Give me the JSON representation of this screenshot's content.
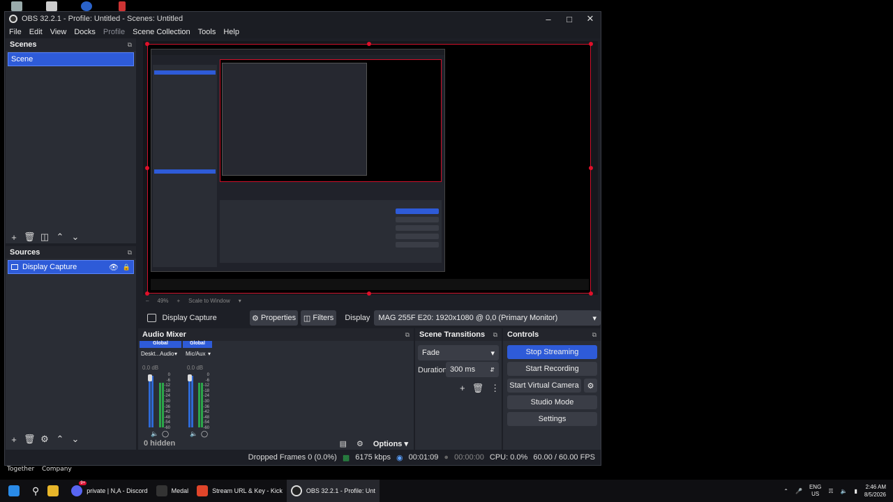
{
  "window": {
    "title": "OBS 32.2.1 - Profile: Untitled - Scenes: Untitled"
  },
  "menu": [
    "File",
    "Edit",
    "View",
    "Docks",
    "Profile",
    "Scene Collection",
    "Tools",
    "Help"
  ],
  "scenes": {
    "title": "Scenes",
    "items": [
      "Scene"
    ]
  },
  "sources": {
    "title": "Sources",
    "items": [
      "Display Capture"
    ]
  },
  "preview": {
    "zoom": "49%",
    "scale_mode": "Scale to Window"
  },
  "source_toolbar": {
    "source_name": "Display Capture",
    "properties_label": "Properties",
    "filters_label": "Filters",
    "display_label": "Display",
    "display_value": "MAG 255F E20: 1920x1080 @ 0,0 (Primary Monitor)"
  },
  "audio_mixer": {
    "title": "Audio Mixer",
    "channels": [
      {
        "badge": "Global",
        "name": "Deskt...Audio",
        "db": "0.0 dB"
      },
      {
        "badge": "Global",
        "name": "Mic/Aux",
        "db": "0.0 dB"
      }
    ],
    "scale": [
      "0",
      "-6",
      "-12",
      "-18",
      "-24",
      "-30",
      "-36",
      "-42",
      "-48",
      "-54",
      "-60"
    ],
    "hidden_label": "0 hidden",
    "options_label": "Options"
  },
  "scene_transitions": {
    "title": "Scene Transitions",
    "transition": "Fade",
    "duration_label": "Duration",
    "duration_value": "300 ms"
  },
  "controls": {
    "title": "Controls",
    "stop_streaming": "Stop Streaming",
    "start_recording": "Start Recording",
    "start_virtual_camera": "Start Virtual Camera",
    "studio_mode": "Studio Mode",
    "settings": "Settings"
  },
  "status": {
    "dropped_frames": "Dropped Frames 0 (0.0%)",
    "bitrate": "6175 kbps",
    "stream_time": "00:01:09",
    "record_time": "00:00:00",
    "cpu": "CPU: 0.0%",
    "fps": "60.00 / 60.00 FPS"
  },
  "desktop": {
    "label_together": "Together",
    "label_company": "Company"
  },
  "taskbar": {
    "items": [
      "private | N,A - Discord",
      "Medal",
      "Stream URL & Key - Kick",
      "OBS 32.2.1 - Profile: Unt"
    ],
    "lang": "ENG",
    "region": "US",
    "time": "2:46 AM",
    "date": "8/5/2026",
    "discord_badge": "9+"
  },
  "colors": {
    "accent": "#2e5bd8",
    "selection_border": "#d0102a"
  }
}
